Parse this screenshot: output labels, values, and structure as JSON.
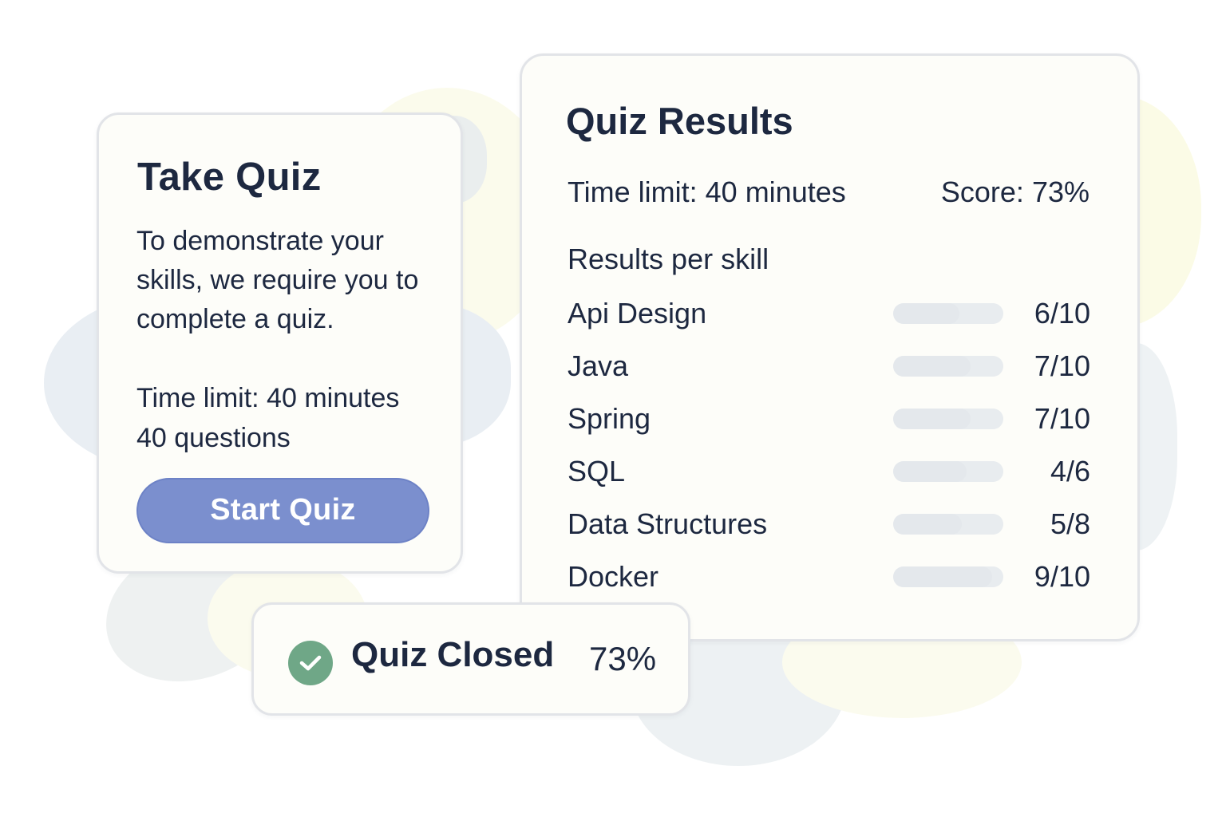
{
  "take_quiz": {
    "title": "Take Quiz",
    "description": "To demonstrate your skills, we require you to complete a quiz.",
    "time_limit": "Time limit: 40 minutes",
    "questions": "40 questions",
    "start_button": "Start Quiz"
  },
  "results": {
    "title": "Quiz Results",
    "time_limit": "Time limit: 40 minutes",
    "score": "Score: 73%",
    "subtitle": "Results per skill",
    "skills": [
      {
        "name": "Api Design",
        "score": "6/10",
        "fraction": 0.6
      },
      {
        "name": "Java",
        "score": "7/10",
        "fraction": 0.7
      },
      {
        "name": "Spring",
        "score": "7/10",
        "fraction": 0.7
      },
      {
        "name": "SQL",
        "score": "4/6",
        "fraction": 0.667
      },
      {
        "name": "Data Structures",
        "score": "5/8",
        "fraction": 0.625
      },
      {
        "name": "Docker",
        "score": "9/10",
        "fraction": 0.9
      }
    ]
  },
  "closed": {
    "label": "Quiz Closed",
    "score": "73%",
    "icon": "check-circle-icon"
  },
  "colors": {
    "accent": "#7b8fce",
    "success": "#6fa787",
    "text": "#1d2840"
  }
}
